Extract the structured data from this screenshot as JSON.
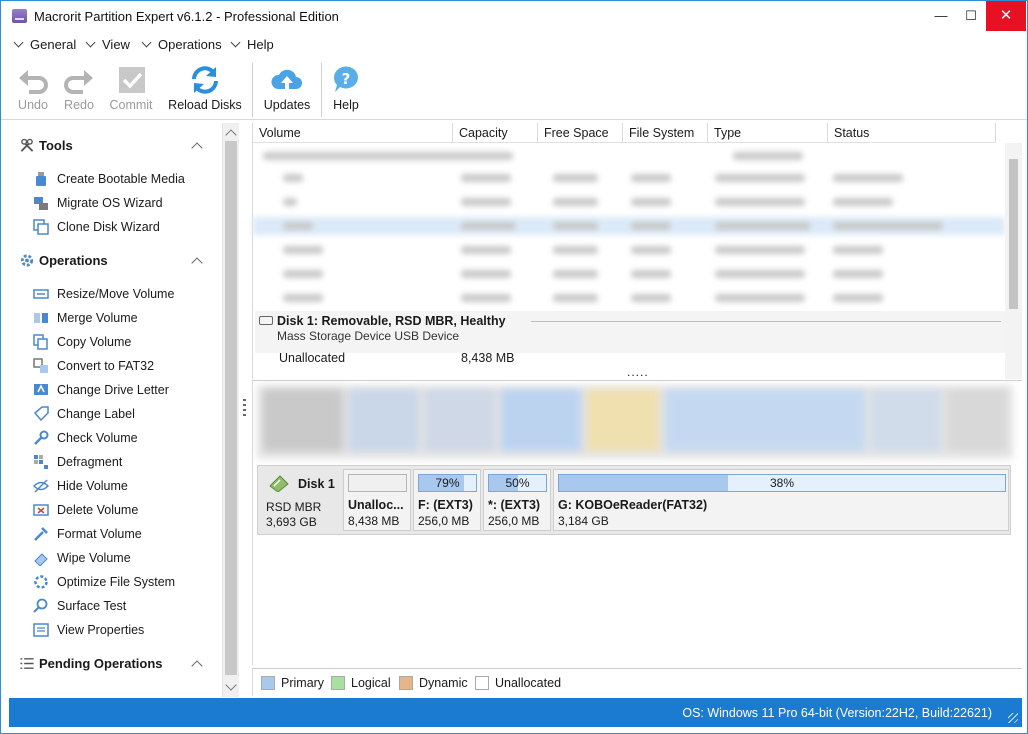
{
  "window": {
    "title": "Macrorit Partition Expert v6.1.2 - Professional Edition",
    "controls": {
      "minimize": "—",
      "maximize": "☐",
      "close": "✕"
    }
  },
  "menu": [
    {
      "label": "General"
    },
    {
      "label": "View"
    },
    {
      "label": "Operations"
    },
    {
      "label": "Help"
    }
  ],
  "toolbar": {
    "undo": "Undo",
    "redo": "Redo",
    "commit": "Commit",
    "reload": "Reload Disks",
    "updates": "Updates",
    "help": "Help"
  },
  "sidebar": {
    "tools": {
      "title": "Tools",
      "items": [
        "Create Bootable Media",
        "Migrate OS Wizard",
        "Clone Disk Wizard"
      ]
    },
    "operations": {
      "title": "Operations",
      "items": [
        "Resize/Move Volume",
        "Merge Volume",
        "Copy Volume",
        "Convert to FAT32",
        "Change Drive Letter",
        "Change Label",
        "Check Volume",
        "Defragment",
        "Hide Volume",
        "Delete Volume",
        "Format Volume",
        "Wipe Volume",
        "Optimize File System",
        "Surface Test",
        "View Properties"
      ]
    },
    "pending": {
      "title": "Pending Operations"
    }
  },
  "columns": [
    "Volume",
    "Capacity",
    "Free Space",
    "File System",
    "Type",
    "Status"
  ],
  "disk1": {
    "title": "Disk 1: Removable, RSD MBR, Healthy",
    "subtitle": "Mass Storage Device USB Device",
    "unallocated_label": "Unallocated",
    "unallocated_size": "8,438 MB",
    "more": "....."
  },
  "diskmap": {
    "name": "Disk 1",
    "type": "RSD MBR",
    "size": "3,693 GB",
    "partitions": [
      {
        "name": "Unalloc...",
        "size": "8,438 MB",
        "percent": "",
        "kind": "unallocated"
      },
      {
        "name": "F: (EXT3)",
        "size": "256,0 MB",
        "percent": "79%",
        "fill": 0.79,
        "kind": "primary"
      },
      {
        "name": "*: (EXT3)",
        "size": "256,0 MB",
        "percent": "50%",
        "fill": 0.5,
        "kind": "primary"
      },
      {
        "name": "G: KOBOeReader(FAT32)",
        "size": "3,184 GB",
        "percent": "38%",
        "fill": 0.38,
        "kind": "primary"
      }
    ]
  },
  "legend": [
    {
      "label": "Primary",
      "color": "#a9c8ee"
    },
    {
      "label": "Logical",
      "color": "#a8e0a0"
    },
    {
      "label": "Dynamic",
      "color": "#e8b48a"
    },
    {
      "label": "Unallocated",
      "color": "#ffffff"
    }
  ],
  "status": {
    "os": "OS: Windows 11 Pro 64-bit (Version:22H2, Build:22621)"
  },
  "colors": {
    "accent": "#1a7bd1",
    "close": "#e81123",
    "selection": "#dbeaf8"
  }
}
